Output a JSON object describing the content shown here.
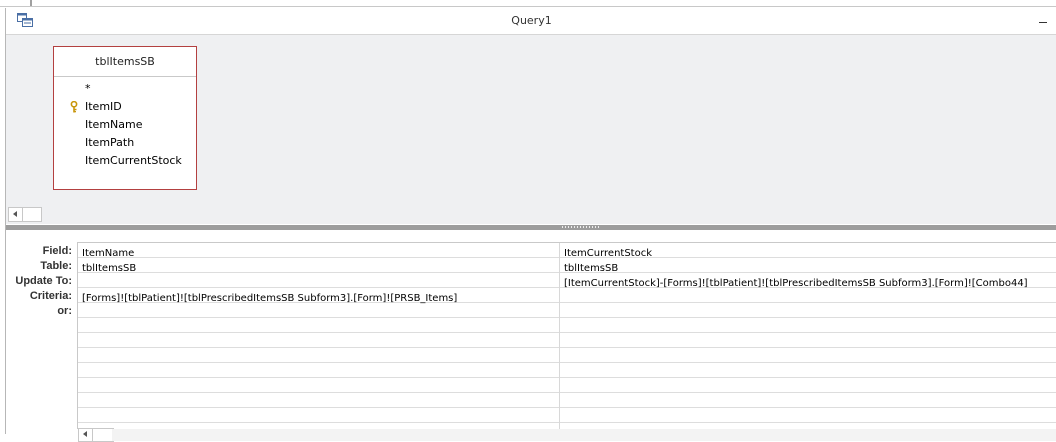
{
  "window": {
    "title": "Query1"
  },
  "design_pane": {
    "table": {
      "name": "tblItemsSB",
      "fields": [
        {
          "label": "*",
          "primary_key": false
        },
        {
          "label": "ItemID",
          "primary_key": true
        },
        {
          "label": "ItemName",
          "primary_key": false
        },
        {
          "label": "ItemPath",
          "primary_key": false
        },
        {
          "label": "ItemCurrentStock",
          "primary_key": false
        }
      ]
    }
  },
  "grid": {
    "row_labels": {
      "field": "Field:",
      "table": "Table:",
      "update_to": "Update To:",
      "criteria": "Criteria:",
      "or": "or:"
    },
    "columns": [
      {
        "field": "ItemName",
        "table": "tblItemsSB",
        "update_to": "",
        "criteria": "[Forms]![tblPatient]![tblPrescribedItemsSB Subform3].[Form]![PRSB_Items]",
        "or": ""
      },
      {
        "field": "ItemCurrentStock",
        "table": "tblItemsSB",
        "update_to": "[ItemCurrentStock]-[Forms]![tblPatient]![tblPrescribedItemsSB Subform3].[Form]![Combo44]",
        "criteria": "",
        "or": ""
      }
    ]
  },
  "colors": {
    "table_border": "#b34040",
    "design_background": "#eff0f2",
    "splitter": "#9d9d9d",
    "key_icon": "#d4a017"
  }
}
